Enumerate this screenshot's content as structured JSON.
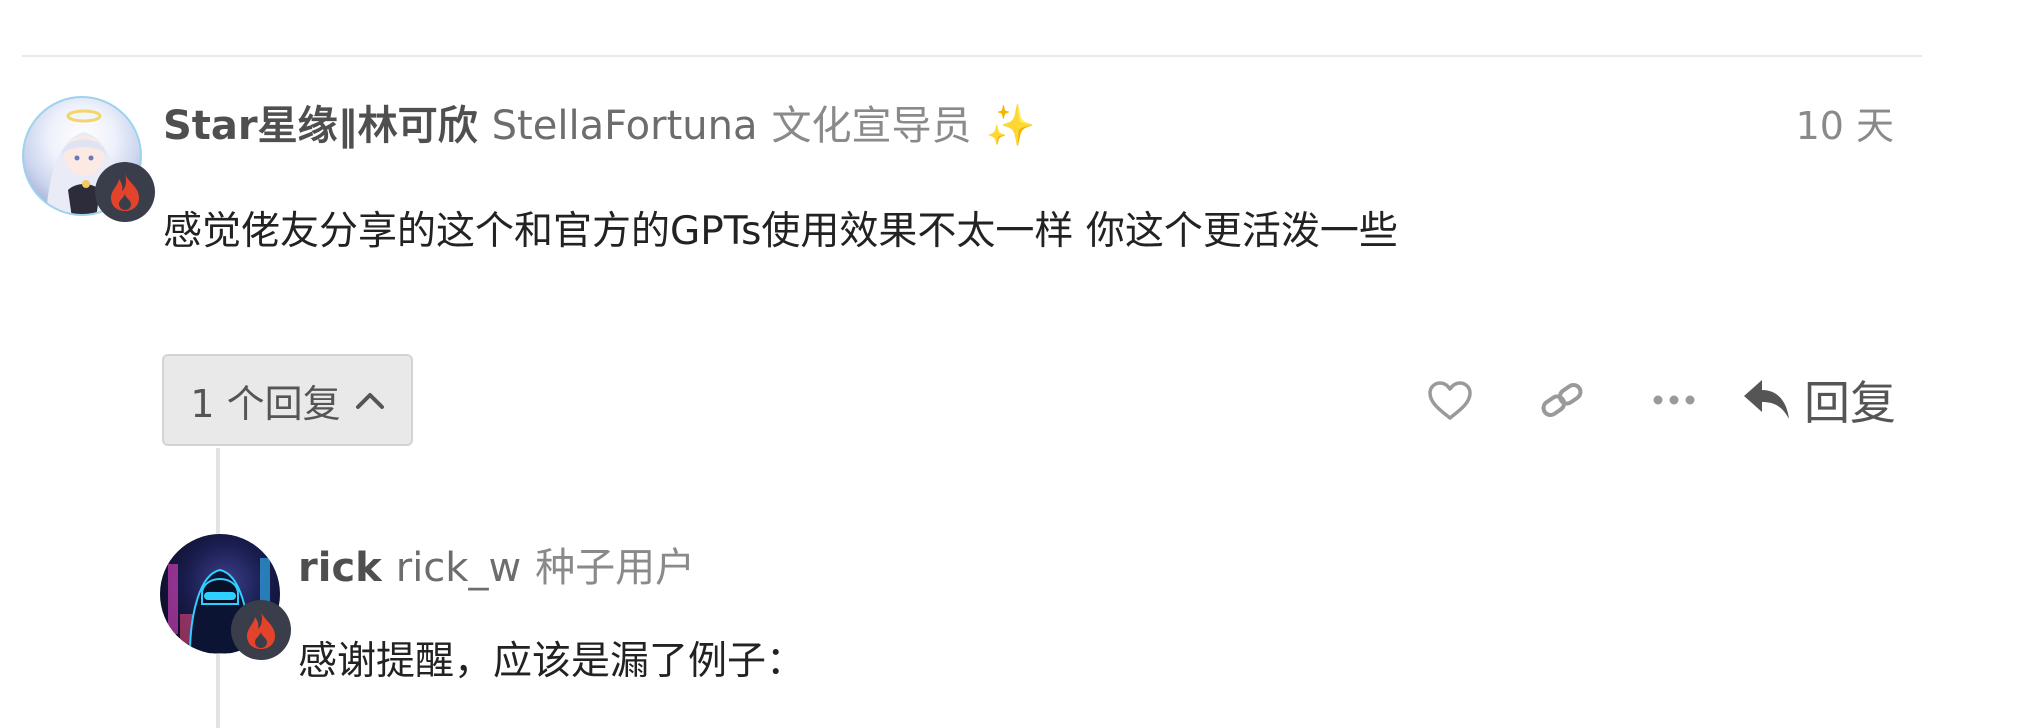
{
  "post": {
    "display_name": "Star星缘‖林可欣",
    "username": "StellaFortuna",
    "user_title": "文化宣导员",
    "title_emoji": "✨",
    "date": "10 天",
    "body": "感觉佬友分享的这个和官方的GPTs使用效果不太一样 你这个更活泼一些",
    "avatar_icon": "anime-girl-avatar",
    "flair_icon": "fire-icon",
    "flair_color": "#e4432b"
  },
  "replies_toggle": {
    "label": "1 个回复",
    "icon": "chevron-up-icon"
  },
  "actions": {
    "like_icon": "heart-icon",
    "link_icon": "link-icon",
    "more_icon": "ellipsis-icon",
    "reply_icon": "reply-arrow-icon",
    "reply_label": "回复"
  },
  "reply": {
    "display_name": "rick",
    "username": "rick_w",
    "user_title": "种子用户",
    "body": "感谢提醒，应该是漏了例子：",
    "avatar_icon": "neon-hooded-figure-avatar",
    "flair_icon": "fire-icon"
  },
  "colors": {
    "divider": "#e9e9e9",
    "muted_text": "#8a8a8a",
    "button_bg": "#e9e9e9",
    "icon_gray": "#9a9a9a"
  }
}
